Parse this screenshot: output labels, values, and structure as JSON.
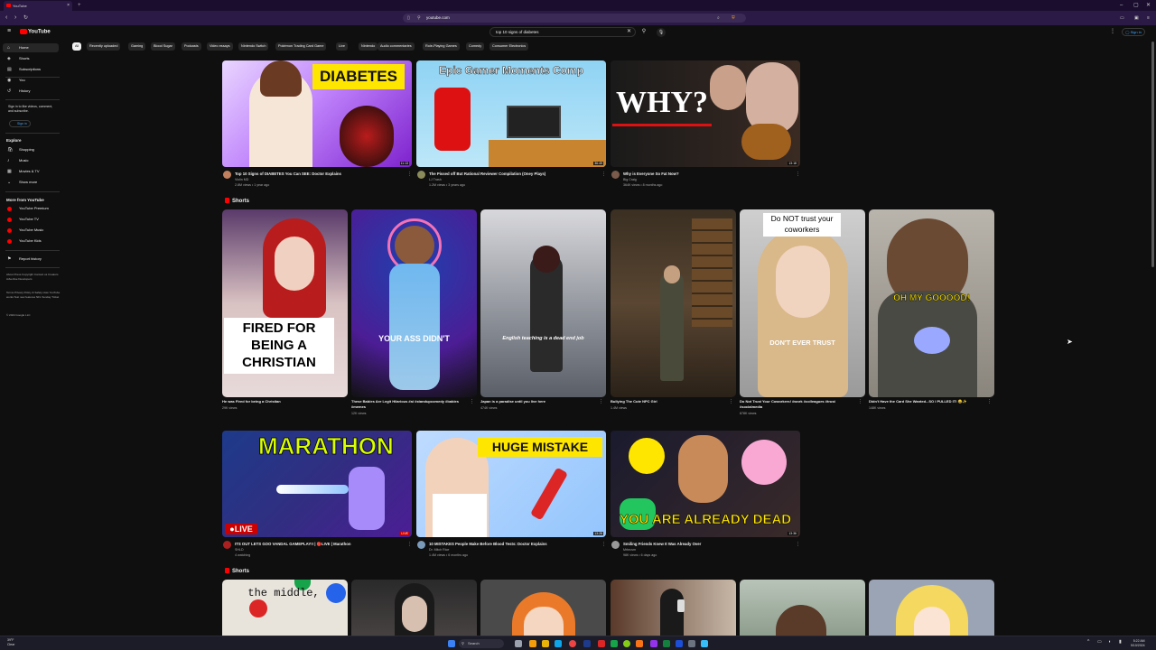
{
  "browser": {
    "tab_title": "YouTube",
    "tab_close": "×",
    "new_tab": "+",
    "url": "youtube.com",
    "window_controls": [
      "–",
      "▢",
      "✕"
    ]
  },
  "header": {
    "logo_text": "YouTube",
    "search_value": "top 10 signs of diabetes",
    "sign_in": "Sign in"
  },
  "sidebar": {
    "main": [
      {
        "label": "Home",
        "icon": "home-icon",
        "glyph": "⌂"
      },
      {
        "label": "Shorts",
        "icon": "shorts-icon",
        "glyph": "◈"
      },
      {
        "label": "Subscriptions",
        "icon": "subscriptions-icon",
        "glyph": "▤"
      },
      {
        "label": "You",
        "icon": "you-icon",
        "glyph": "◉"
      },
      {
        "label": "History",
        "icon": "history-icon",
        "glyph": "↺"
      }
    ],
    "signin_prompt": "Sign in to like videos, comment, and subscribe.",
    "signin_button": "Sign in",
    "explore_title": "Explore",
    "explore": [
      {
        "label": "Shopping",
        "glyph": "🛍"
      },
      {
        "label": "Music",
        "glyph": "♪"
      },
      {
        "label": "Movies & TV",
        "glyph": "▦"
      },
      {
        "label": "Show more",
        "glyph": "⌄"
      }
    ],
    "more_title": "More from YouTube",
    "more": [
      "YouTube Premium",
      "YouTube TV",
      "YouTube Music",
      "YouTube Kids"
    ],
    "report_history": "Report history",
    "footer1": "About Press Copyright Contact us Creators Advertise Developers",
    "footer2": "Terms Privacy Policy & Safety How YouTube works Test new features NFL Sunday Ticket",
    "copyright": "© 2024 Google LLC"
  },
  "chips": [
    "All",
    "Recently uploaded",
    "Gaming",
    "Blood Sugar",
    "Podcasts",
    "Video essays",
    "Nintendo Switch",
    "Pokémon Trading Card Game",
    "Live",
    "Nintendo",
    "Audio commentaries",
    "Role-Playing Games",
    "Comedy",
    "Consumer Electronics"
  ],
  "videos_row1": [
    {
      "title": "Top 10 Signs of DIABETES You Can SEE: Doctor Explains",
      "channel": "Violin MD",
      "meta": "2.8M views • 1 year ago",
      "duration": "11:13",
      "overlay": "DIABETES"
    },
    {
      "title": "The Pissed off But Rational Reviewer Compilation (Oney Plays)",
      "channel": "LJ Trash",
      "meta": "1.2M views • 3 years ago",
      "duration": "36:49",
      "overlay": "Epic Gamer Moments Comp"
    },
    {
      "title": "Why is Everyone So Fat Now?",
      "channel": "Big Craig",
      "meta": "364K views • 8 months ago",
      "duration": "13:18",
      "overlay": "WHY?"
    }
  ],
  "shorts_title": "Shorts",
  "shorts_row1": [
    {
      "title": "He was Fired for being a Christian",
      "views": "29K views",
      "overlay": "FIRED FOR BEING A CHRISTIAN"
    },
    {
      "title": "These Babies Are Legit Hilarious #ai #standupcomedy #babies #memes",
      "views": "12K views",
      "overlay": "YOUR ASS DIDN'T"
    },
    {
      "title": "Japan is a paradise until you live here",
      "views": "474K views",
      "overlay": "English teaching is a dead end job"
    },
    {
      "title": "Bullying The Cute NPC Girl",
      "views": "1.4M views",
      "overlay": ""
    },
    {
      "title": "Do Not Trust Your Coworkers! #work #colleagues #trust #socialmedia",
      "views": "878K views",
      "overlay_top": "Do NOT trust your coworkers",
      "overlay": "DON'T EVER TRUST"
    },
    {
      "title": "Didn't Have the Card She Wanted...SO I PULLED IT! 😂✨",
      "views": "148K views",
      "overlay": "OH MY GOOOOD!"
    }
  ],
  "videos_row2": [
    {
      "title": "ITS OUT LETS GOO VANDAL GAMEPLAY!! | 🔴LIVE | Marathon",
      "channel": "SHLD",
      "meta": "4 watching",
      "badge": "LIVE",
      "overlay": "MARATHON",
      "live_label": "LIVE"
    },
    {
      "title": "10 MISTAKES People Make Before Blood Tests: Doctor Explains",
      "channel": "Dr. Mitch Rice",
      "meta": "1.4M views • 6 months ago",
      "duration": "13:28",
      "overlay": "HUGE MISTAKE"
    },
    {
      "title": "Smiling Friends Knew It Was Already Over",
      "channel": "Mrbruvm",
      "meta": "98K views • 6 days ago",
      "duration": "13:36",
      "overlay": "YOU ARE ALREADY DEAD"
    }
  ],
  "shorts_row2": [
    {
      "overlay": "the middle,"
    },
    {
      "overlay": ""
    },
    {
      "overlay": ""
    },
    {
      "overlay": ""
    },
    {
      "overlay": ""
    },
    {
      "overlay": ""
    }
  ],
  "taskbar": {
    "weather_temp": "39°F",
    "weather_desc": "Clear",
    "search": "Search",
    "time": "5:22 AM",
    "date": "5/10/2024"
  },
  "colors": {
    "yt_red": "#ff0000",
    "link_blue": "#3ea6ff",
    "background": "#0f0f0f"
  }
}
